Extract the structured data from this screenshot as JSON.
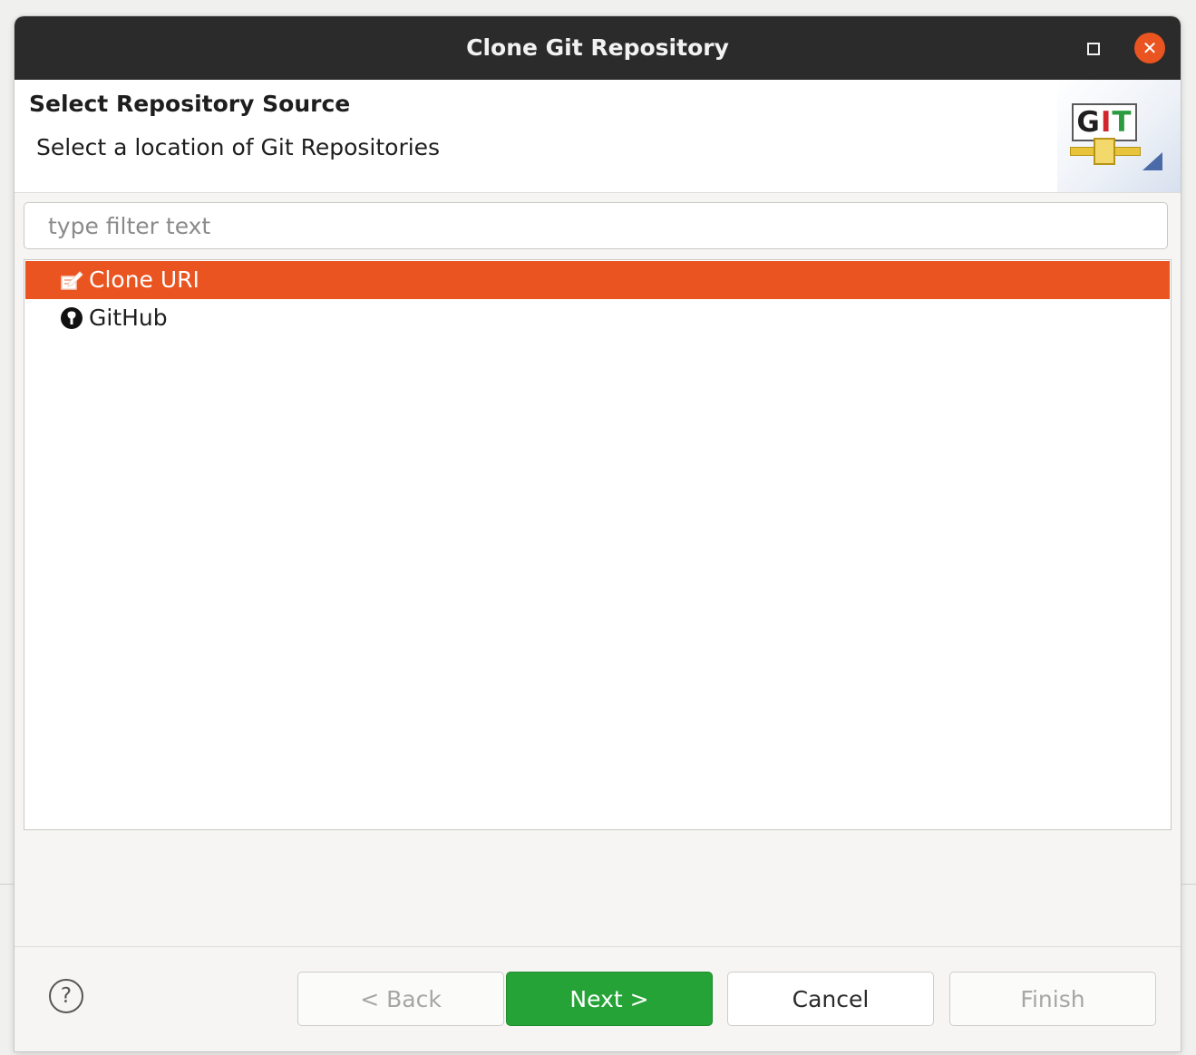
{
  "window": {
    "title": "Clone Git Repository"
  },
  "header": {
    "title": "Select Repository Source",
    "description": "Select a location of Git Repositories",
    "logo_text": "GIT"
  },
  "filter": {
    "placeholder": "type filter text",
    "value": ""
  },
  "sources": [
    {
      "label": "Clone URI",
      "icon": "clone-uri-icon",
      "selected": true
    },
    {
      "label": "GitHub",
      "icon": "github-icon",
      "selected": false
    }
  ],
  "footer": {
    "help_label": "?",
    "back_label": "< Back",
    "next_label": "Next >",
    "cancel_label": "Cancel",
    "finish_label": "Finish"
  },
  "colors": {
    "accent": "#e95420",
    "primary_button": "#26a337",
    "titlebar": "#2b2b2b"
  }
}
